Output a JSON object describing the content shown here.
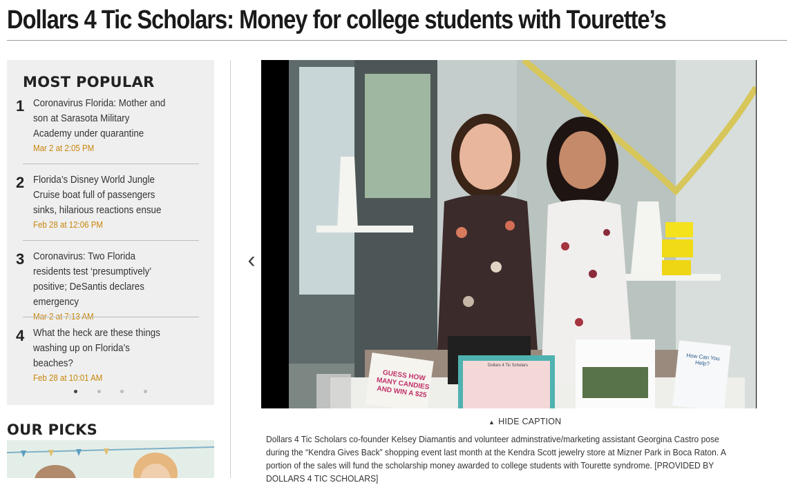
{
  "article": {
    "headline": "Dollars 4 Tic Scholars: Money for college students with Tourette’s"
  },
  "most_popular": {
    "title": "MOST POPULAR",
    "items": [
      {
        "number": "1",
        "title": "Coronavirus Florida: Mother and son at Sarasota Military Academy under quarantine",
        "date": "Mar 2 at 2:05 PM"
      },
      {
        "number": "2",
        "title": "Florida’s Disney World Jungle Cruise boat full of passengers sinks, hilarious reactions ensue",
        "date": "Feb 28 at 12:06 PM"
      },
      {
        "number": "3",
        "title": "Coronavirus: Two Florida residents test ‘presumptively’ positive; DeSantis declares emergency",
        "date": "Mar 2 at 7:13 AM"
      },
      {
        "number": "4",
        "title": "What the heck are these things washing up on Florida’s beaches?",
        "date": "Feb 28 at 10:01 AM"
      }
    ],
    "page_count": 4,
    "active_page": 1
  },
  "our_picks": {
    "title": "OUR PICKS"
  },
  "gallery": {
    "prev_icon": "chevron-left-icon",
    "caption_toggle": "HIDE CAPTION",
    "caption": "Dollars 4 Tic Scholars co-founder Kelsey Diamantis and volunteer adminstrative/marketing assistant Georgina Castro pose during the “Kendra Gives Back” shopping event last month at the Kendra Scott jewelry store at Mizner Park in Boca Raton. A portion of the sales will fund the scholarship money awarded to college students with Tourette syndrome. [PROVIDED BY DOLLARS 4 TIC SCHOLARS]",
    "signs": {
      "candy_sign": "GUESS HOW MANY CANDIES AND WIN A $25",
      "poster_header": "Dollars 4 Tic Scholars",
      "flyer_header": "How Can You Help?"
    }
  },
  "colors": {
    "date_accent": "#c8860a",
    "sidebar_bg": "#efefef"
  }
}
